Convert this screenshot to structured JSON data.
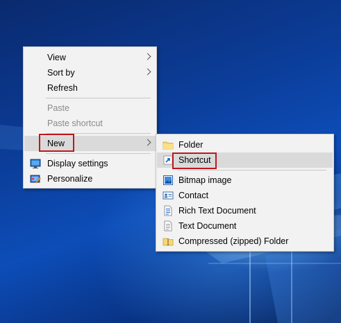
{
  "context_menu": {
    "items": [
      {
        "label": "View",
        "has_submenu": true,
        "enabled": true
      },
      {
        "label": "Sort by",
        "has_submenu": true,
        "enabled": true
      },
      {
        "label": "Refresh",
        "has_submenu": false,
        "enabled": true
      },
      {
        "label": "Paste",
        "has_submenu": false,
        "enabled": false
      },
      {
        "label": "Paste shortcut",
        "has_submenu": false,
        "enabled": false
      },
      {
        "label": "New",
        "has_submenu": true,
        "enabled": true,
        "highlighted": true
      },
      {
        "label": "Display settings",
        "icon": "monitor-icon",
        "enabled": true
      },
      {
        "label": "Personalize",
        "icon": "personalize-icon",
        "enabled": true
      }
    ]
  },
  "new_submenu": {
    "items": [
      {
        "label": "Folder",
        "icon": "folder-icon"
      },
      {
        "label": "Shortcut",
        "icon": "shortcut-icon",
        "highlighted": true
      },
      {
        "label": "Bitmap image",
        "icon": "bitmap-image-icon"
      },
      {
        "label": "Contact",
        "icon": "contact-icon"
      },
      {
        "label": "Rich Text Document",
        "icon": "rich-text-document-icon"
      },
      {
        "label": "Text Document",
        "icon": "text-document-icon"
      },
      {
        "label": "Compressed (zipped) Folder",
        "icon": "zip-folder-icon"
      }
    ]
  },
  "colors": {
    "menu_background": "#f2f2f2",
    "hover_background": "#dadada",
    "highlight_outline": "#c0161b",
    "disabled_text": "#8a8a8a",
    "desktop_blue": "#0b3c97"
  }
}
